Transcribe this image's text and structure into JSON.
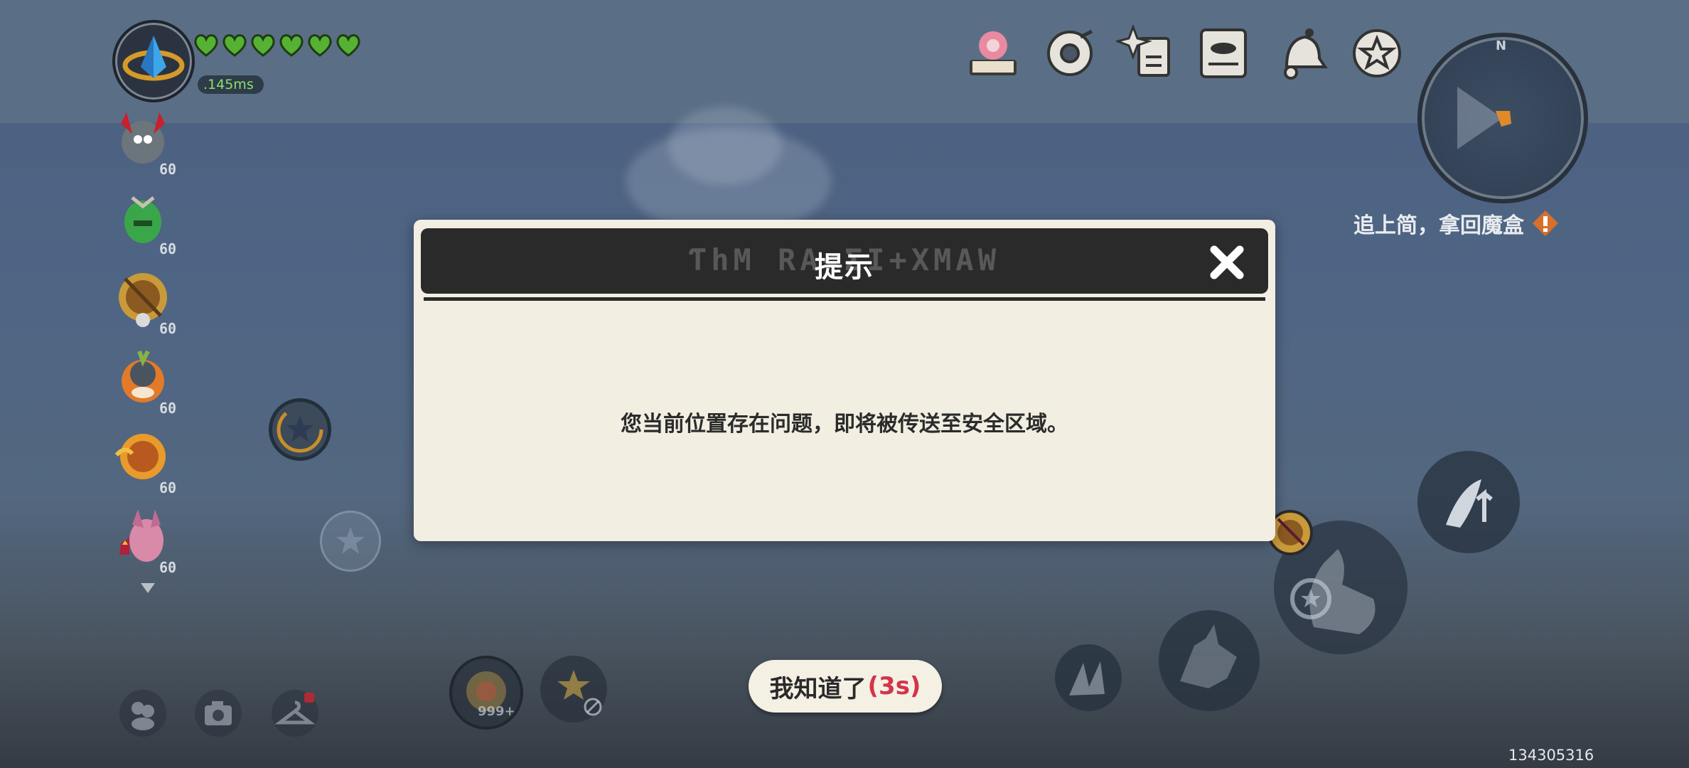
{
  "player": {
    "health_hearts": 6,
    "ping": ".145ms",
    "heart_color": "#56b233"
  },
  "pets": [
    {
      "name": "horned-pet-icon",
      "level": "60"
    },
    {
      "name": "green-pet-icon",
      "level": "60"
    },
    {
      "name": "armored-pet-icon",
      "level": "60"
    },
    {
      "name": "orange-pet-icon",
      "level": "60"
    },
    {
      "name": "fire-pet-icon",
      "level": "60"
    },
    {
      "name": "pink-pet-icon",
      "level": "60"
    }
  ],
  "top_menu": [
    "book-flower-icon",
    "ring-icon",
    "sparkle-card-icon",
    "notebook-icon",
    "bell-icon",
    "star-badge-icon"
  ],
  "minimap": {
    "north_label": "N"
  },
  "quest": {
    "text": "追上简，拿回魔盒"
  },
  "dialog": {
    "title": "提示",
    "deco_text": "ƬhM RA<ΣI+XMAW",
    "message": "您当前位置存在问题，即将被传送至安全区域。",
    "close_label": "✕"
  },
  "confirm": {
    "label": "我知道了",
    "countdown": "(3s)"
  },
  "hotbar": {
    "item_count": "999+"
  },
  "uid": "134305316",
  "colors": {
    "accent_red": "#d4344a",
    "dialog_bg": "#f2eee2",
    "dialog_header": "#2a2a2a"
  }
}
